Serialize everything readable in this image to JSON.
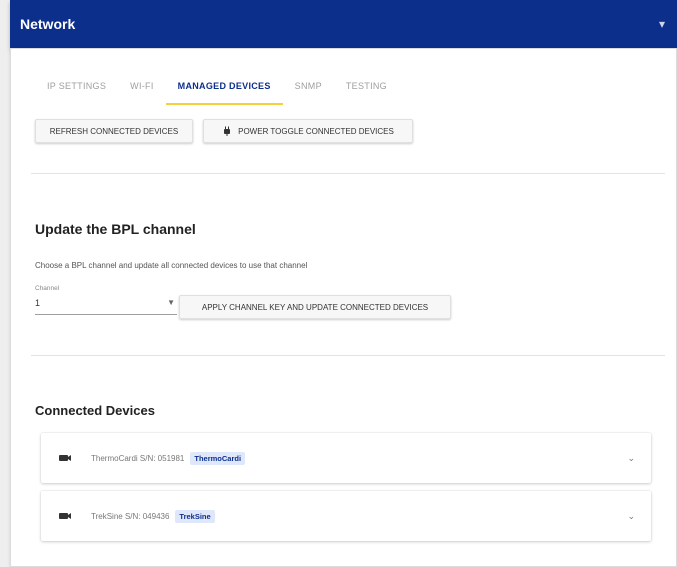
{
  "header": {
    "title": "Network"
  },
  "tabs": [
    {
      "label": "IP Settings",
      "active": false
    },
    {
      "label": "Wi-Fi",
      "active": false
    },
    {
      "label": "Managed Devices",
      "active": true
    },
    {
      "label": "SNMP",
      "active": false
    },
    {
      "label": "Testing",
      "active": false
    }
  ],
  "actions": {
    "refresh_label": "Refresh Connected Devices",
    "power_toggle_label": "Power Toggle Connected Devices"
  },
  "bpl": {
    "title": "Update the BPL channel",
    "description": "Choose a BPL channel and update all connected devices to use that channel",
    "channel_label": "Channel",
    "channel_value": "1",
    "apply_label": "Apply channel key and update connected devices"
  },
  "connected": {
    "title": "Connected Devices",
    "devices": [
      {
        "name": "ThermoCardi S/N: 051981",
        "badge": "ThermoCardi"
      },
      {
        "name": "TrekSine S/N: 049436",
        "badge": "TrekSine"
      }
    ]
  },
  "colors": {
    "brand": "#0c2f8c",
    "tab_indicator": "#f6cf3c",
    "badge_bg": "#dfe7fb"
  }
}
